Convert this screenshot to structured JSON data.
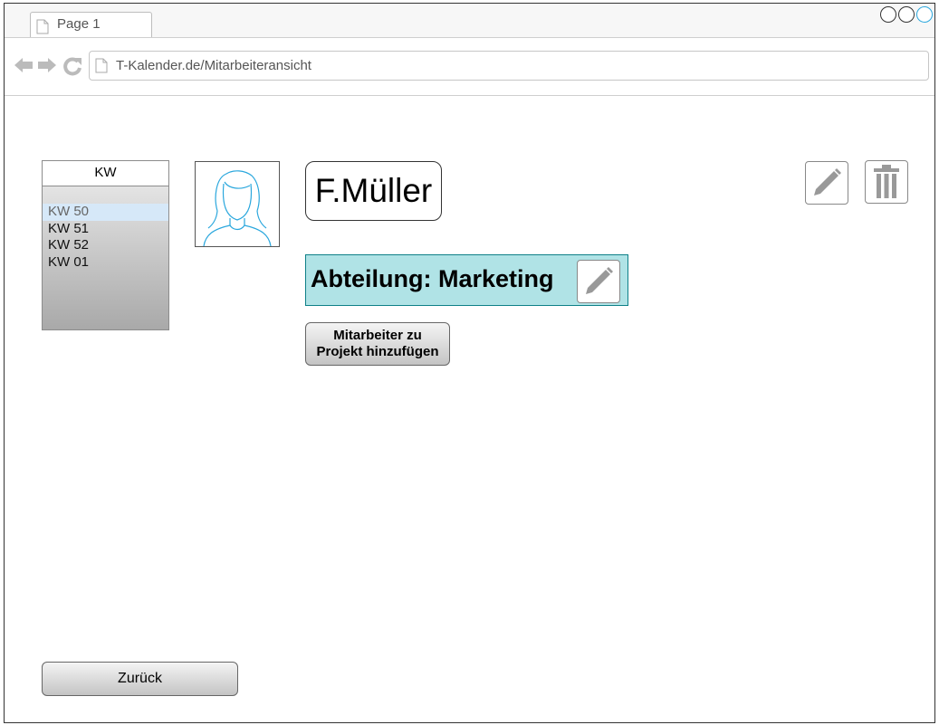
{
  "browser": {
    "tab_label": "Page 1",
    "url": "T-Kalender.de/Mitarbeiteransicht"
  },
  "kw_list": {
    "header": "KW",
    "items": [
      "KW 50",
      "KW 51",
      "KW 52",
      "KW 01"
    ],
    "selected": "KW 50"
  },
  "employee": {
    "name": "F.Müller",
    "department_label": "Abteilung: Marketing"
  },
  "buttons": {
    "add_to_project": "Mitarbeiter zu\nProjekt hinzufügen",
    "back": "Zurück"
  },
  "icons": {
    "edit": "pencil-icon",
    "delete": "trash-icon",
    "avatar": "user-female-icon"
  },
  "colors": {
    "department_fill": "#b0e3e6",
    "selected_item": "#d6e8f8",
    "window_control_accent": "#2aa7dd"
  }
}
